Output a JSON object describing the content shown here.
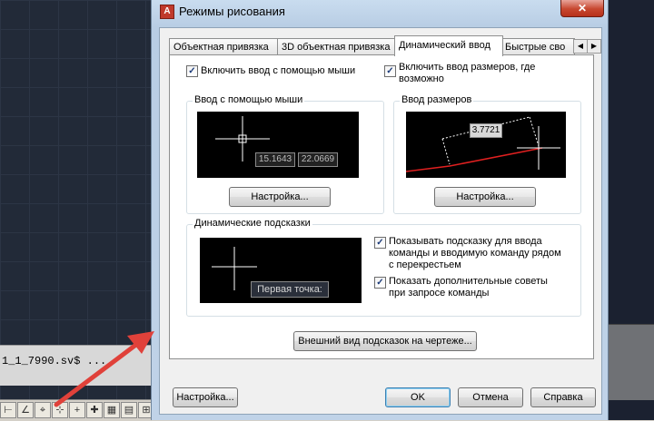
{
  "dialog": {
    "title": "Режимы рисования",
    "tabs": [
      {
        "label": "Объектная привязка",
        "active": false
      },
      {
        "label": "3D объектная привязка",
        "active": false
      },
      {
        "label": "Динамический ввод",
        "active": true
      },
      {
        "label": "Быстрые сво",
        "active": false
      }
    ],
    "tab_scroll_left": "◀",
    "tab_scroll_right": "▶",
    "close_label": "✕"
  },
  "dynamic_input": {
    "pointer_input_enabled_label": "Включить ввод с помощью мыши",
    "pointer_input_enabled": true,
    "dimension_input_enabled_label_line1": "Включить ввод размеров, где",
    "dimension_input_enabled_label_line2": "возможно",
    "dimension_input_enabled": true,
    "pointer_group_title": "Ввод с помощью мыши",
    "pointer_preview_values": [
      "15.1643",
      "22.0669"
    ],
    "pointer_settings_button": "Настройка...",
    "dimension_group_title": "Ввод размеров",
    "dimension_preview_value": "3.7721",
    "dimension_settings_button": "Настройка...",
    "prompts_group_title": "Динамические подсказки",
    "prompts_preview_text": "Первая точка:",
    "show_prompts_label_line1": "Показывать подсказку для ввода",
    "show_prompts_label_line2": "команды и вводимую команду рядом",
    "show_prompts_label_line3": "с перекрестьем",
    "show_prompts": true,
    "show_extra_tips_label_line1": "Показать дополнительные советы",
    "show_extra_tips_label_line2": "при запросе команды",
    "show_extra_tips": true,
    "appearance_button": "Внешний вид подсказок на чертеже..."
  },
  "footer": {
    "options_button": "Настройка...",
    "ok_button": "OK",
    "cancel_button": "Отмена",
    "help_button": "Справка"
  },
  "background": {
    "command_line_text": "1_1_7990.sv$ ...",
    "accent_arrow_color": "#e0413a"
  }
}
